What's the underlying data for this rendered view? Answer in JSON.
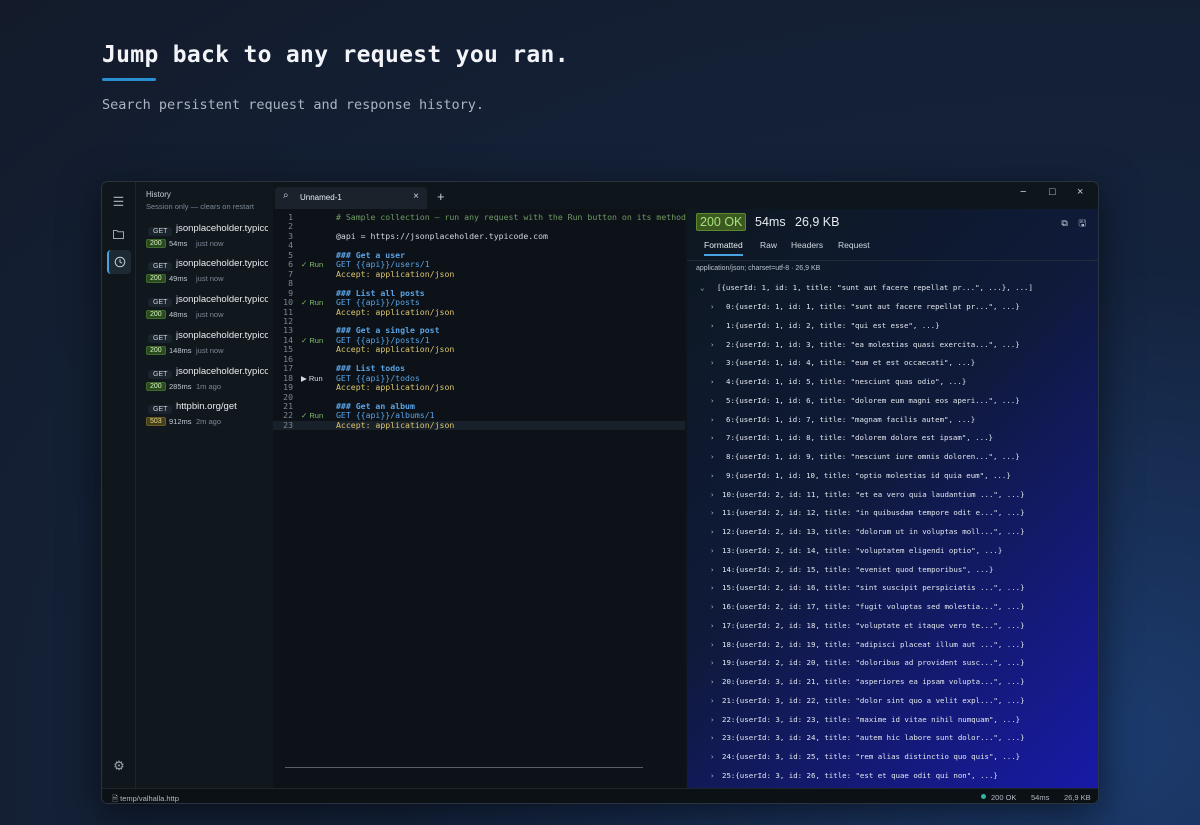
{
  "hero": {
    "title": "Jump back to any request you ran.",
    "subtitle": "Search persistent request and response history."
  },
  "history": {
    "title": "History",
    "subtitle": "Session only — clears on restart",
    "items": [
      {
        "method": "GET",
        "url": "jsonplaceholder.typicode.com",
        "status": "200",
        "time": "54ms",
        "ago": "just now",
        "ok": true
      },
      {
        "method": "GET",
        "url": "jsonplaceholder.typicode.com",
        "status": "200",
        "time": "49ms",
        "ago": "just now",
        "ok": true
      },
      {
        "method": "GET",
        "url": "jsonplaceholder.typicode.com",
        "status": "200",
        "time": "48ms",
        "ago": "just now",
        "ok": true
      },
      {
        "method": "GET",
        "url": "jsonplaceholder.typicode.com",
        "status": "200",
        "time": "148ms",
        "ago": "just now",
        "ok": true
      },
      {
        "method": "GET",
        "url": "jsonplaceholder.typicode.com",
        "status": "200",
        "time": "285ms",
        "ago": "1m ago",
        "ok": true
      },
      {
        "method": "GET",
        "url": "httpbin.org/get",
        "status": "503",
        "time": "912ms",
        "ago": "2m ago",
        "ok": false
      }
    ]
  },
  "tabs": {
    "active_label": "Unnamed-1",
    "add": "+",
    "close": "×"
  },
  "window_controls": {
    "minimize": "−",
    "maximize": "□",
    "close": "×"
  },
  "editor": {
    "lines": [
      {
        "n": "1",
        "text": "# Sample collection — run any request with the Run button on its method",
        "kind": "comment",
        "run": ""
      },
      {
        "n": "2",
        "text": "",
        "kind": "plain",
        "run": ""
      },
      {
        "n": "3",
        "text": "@api = https://jsonplaceholder.typicode.com",
        "kind": "plain",
        "run": ""
      },
      {
        "n": "4",
        "text": "",
        "kind": "plain",
        "run": ""
      },
      {
        "n": "5",
        "text": "### Get a user",
        "kind": "heading",
        "run": ""
      },
      {
        "n": "6",
        "text": "GET {{api}}/users/1",
        "kind": "method",
        "run": "✓ Run"
      },
      {
        "n": "7",
        "text": "Accept: application/json",
        "kind": "header",
        "run": ""
      },
      {
        "n": "8",
        "text": "",
        "kind": "plain",
        "run": ""
      },
      {
        "n": "9",
        "text": "### List all posts",
        "kind": "heading",
        "run": ""
      },
      {
        "n": "10",
        "text": "GET {{api}}/posts",
        "kind": "method",
        "run": "✓ Run"
      },
      {
        "n": "11",
        "text": "Accept: application/json",
        "kind": "header",
        "run": ""
      },
      {
        "n": "12",
        "text": "",
        "kind": "plain",
        "run": ""
      },
      {
        "n": "13",
        "text": "### Get a single post",
        "kind": "heading",
        "run": ""
      },
      {
        "n": "14",
        "text": "GET {{api}}/posts/1",
        "kind": "method",
        "run": "✓ Run"
      },
      {
        "n": "15",
        "text": "Accept: application/json",
        "kind": "header",
        "run": ""
      },
      {
        "n": "16",
        "text": "",
        "kind": "plain",
        "run": ""
      },
      {
        "n": "17",
        "text": "### List todos",
        "kind": "heading",
        "run": ""
      },
      {
        "n": "18",
        "text": "GET {{api}}/todos",
        "kind": "method",
        "run": "▶ Run"
      },
      {
        "n": "19",
        "text": "Accept: application/json",
        "kind": "header",
        "run": ""
      },
      {
        "n": "20",
        "text": "",
        "kind": "plain",
        "run": ""
      },
      {
        "n": "21",
        "text": "### Get an album",
        "kind": "heading",
        "run": ""
      },
      {
        "n": "22",
        "text": "GET {{api}}/albums/1",
        "kind": "method",
        "run": "✓ Run"
      },
      {
        "n": "23",
        "text": "Accept: application/json",
        "kind": "header",
        "run": ""
      }
    ]
  },
  "response": {
    "status": "200 OK",
    "time": "54ms",
    "size": "26,9 KB",
    "tabs": [
      "Formatted",
      "Raw",
      "Headers",
      "Request"
    ],
    "content_type": "application/json; charset=utf-8 · 26,9 KB",
    "root": "[{userId: 1, id: 1, title: \"sunt aut facere repellat pr...\", ...}, ...]",
    "rows": [
      "0:{userId: 1, id: 1, title: \"sunt aut facere repellat pr...\", ...}",
      "1:{userId: 1, id: 2, title: \"qui est esse\", ...}",
      "2:{userId: 1, id: 3, title: \"ea molestias quasi exercita...\", ...}",
      "3:{userId: 1, id: 4, title: \"eum et est occaecati\", ...}",
      "4:{userId: 1, id: 5, title: \"nesciunt quas odio\", ...}",
      "5:{userId: 1, id: 6, title: \"dolorem eum magni eos aperi...\", ...}",
      "6:{userId: 1, id: 7, title: \"magnam facilis autem\", ...}",
      "7:{userId: 1, id: 8, title: \"dolorem dolore est ipsam\", ...}",
      "8:{userId: 1, id: 9, title: \"nesciunt iure omnis doloren...\", ...}",
      "9:{userId: 1, id: 10, title: \"optio molestias id quia eum\", ...}",
      "10:{userId: 2, id: 11, title: \"et ea vero quia laudantium ...\", ...}",
      "11:{userId: 2, id: 12, title: \"in quibusdam tempore odit e...\", ...}",
      "12:{userId: 2, id: 13, title: \"dolorum ut in voluptas moll...\", ...}",
      "13:{userId: 2, id: 14, title: \"voluptatem eligendi optio\", ...}",
      "14:{userId: 2, id: 15, title: \"eveniet quod temporibus\", ...}",
      "15:{userId: 2, id: 16, title: \"sint suscipit perspiciatis ...\", ...}",
      "16:{userId: 2, id: 17, title: \"fugit voluptas sed molestia...\", ...}",
      "17:{userId: 2, id: 18, title: \"voluptate et itaque vero te...\", ...}",
      "18:{userId: 2, id: 19, title: \"adipisci placeat illum aut ...\", ...}",
      "19:{userId: 2, id: 20, title: \"doloribus ad provident susc...\", ...}",
      "20:{userId: 3, id: 21, title: \"asperiores ea ipsam volupta...\", ...}",
      "21:{userId: 3, id: 22, title: \"dolor sint quo a velit expl...\", ...}",
      "22:{userId: 3, id: 23, title: \"maxime id vitae nihil numquam\", ...}",
      "23:{userId: 3, id: 24, title: \"autem hic labore sunt dolor...\", ...}",
      "24:{userId: 3, id: 25, title: \"rem alias distinctio quo quis\", ...}",
      "25:{userId: 3, id: 26, title: \"est et quae odit qui non\", ...}"
    ]
  },
  "statusbar": {
    "file": "temp/valhalla.http",
    "status": "200 OK",
    "time": "54ms",
    "size": "26,9 KB"
  },
  "icons": {
    "menu": "menu-icon",
    "collections": "folder-icon",
    "history": "clock-icon",
    "settings": "gear-icon",
    "search": "search-icon",
    "copy": "copy-icon",
    "save": "save-icon"
  },
  "colors": {
    "accent": "#4aa3df",
    "status_ok": "#a6e27e",
    "status_error": "#e8d48b",
    "status_dot": "#2fb5a2"
  }
}
